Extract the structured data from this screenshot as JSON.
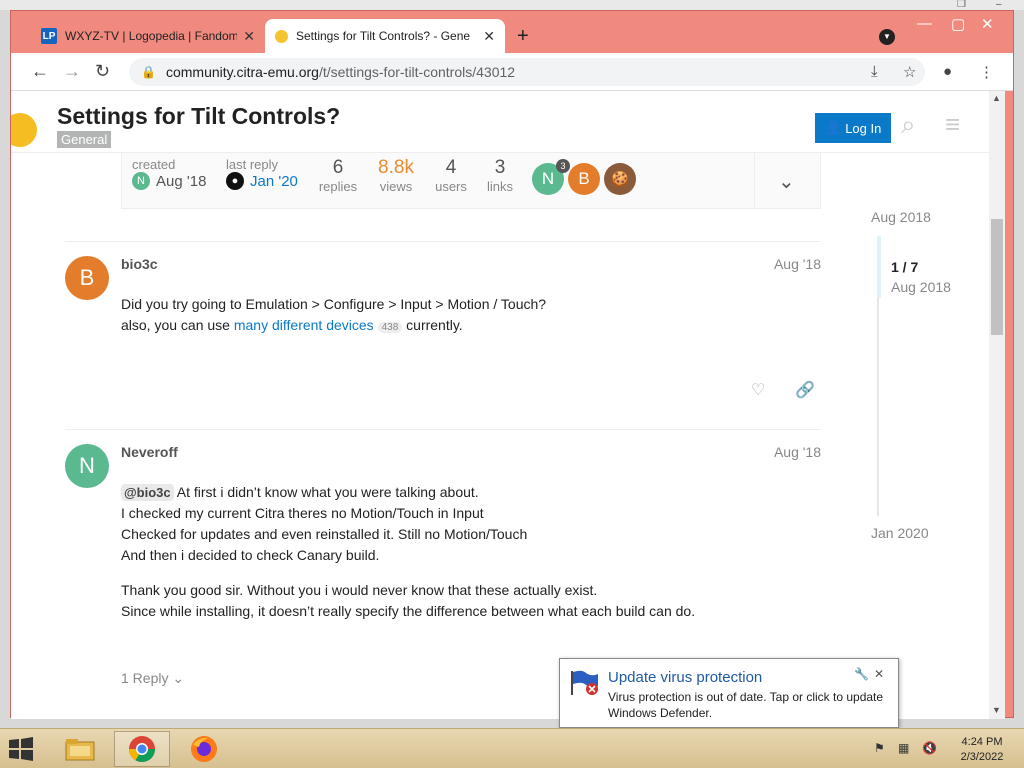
{
  "browser": {
    "tabs": [
      {
        "title": "WXYZ-TV | Logopedia | Fandom",
        "favicon": "lp",
        "active": false
      },
      {
        "title": "Settings for Tilt Controls? - Gene",
        "favicon": "citra",
        "active": true
      }
    ],
    "url_host": "community.citra-emu.org",
    "url_path": "/t/settings-for-tilt-controls/43012",
    "window_theme_color": "#f08a7f"
  },
  "header": {
    "topic_title": "Settings for Tilt Controls?",
    "category": "General",
    "login_label": "Log In",
    "login_icon": "person-icon"
  },
  "summary": {
    "created_label": "created",
    "created_date": "Aug '18",
    "created_avatar": "N",
    "last_reply_label": "last reply",
    "last_reply_date": "Jan '20",
    "stats": [
      {
        "value": "6",
        "label": "replies"
      },
      {
        "value": "8.8k",
        "label": "views"
      },
      {
        "value": "4",
        "label": "users"
      },
      {
        "value": "3",
        "label": "links"
      }
    ],
    "participants": [
      {
        "letter": "N",
        "color": "#5ab98f",
        "count": "3"
      },
      {
        "letter": "B",
        "color": "#e47d2b"
      }
    ]
  },
  "posts": [
    {
      "username": "bio3c",
      "date": "Aug '18",
      "avatar_letter": "B",
      "avatar_color": "#e47d2b",
      "line1": "Did you try going to Emulation > Configure > Input > Motion / Touch?",
      "line2_pre": "also, you can use ",
      "line2_link": "many different devices",
      "line2_clicks": "438",
      "line2_post": " currently."
    },
    {
      "username": "Neveroff",
      "date": "Aug '18",
      "avatar_letter": "N",
      "avatar_color": "#5ab98f",
      "mention": "@bio3c",
      "p1_after_mention": " At first i didn’t know what you were talking about.",
      "p1_l2": "I checked my current Citra theres no Motion/Touch in Input",
      "p1_l3": "Checked for updates and even reinstalled it. Still no Motion/Touch",
      "p1_l4": "And then i decided to check Canary build.",
      "p2_l1": "Thank you good sir. Without you i would never know that these actually exist.",
      "p2_l2": "Since while installing, it doesn’t really specify the difference between what each build can do.",
      "reply_label": "1 Reply"
    }
  ],
  "timeline": {
    "start_date": "Aug 2018",
    "position": "1 / 7",
    "position_date": "Aug 2018",
    "end_date": "Jan 2020"
  },
  "notification": {
    "title": "Update virus protection",
    "body": "Virus protection is out of date. Tap or click to update Windows Defender."
  },
  "taskbar": {
    "time": "4:24 PM",
    "date": "2/3/2022"
  }
}
